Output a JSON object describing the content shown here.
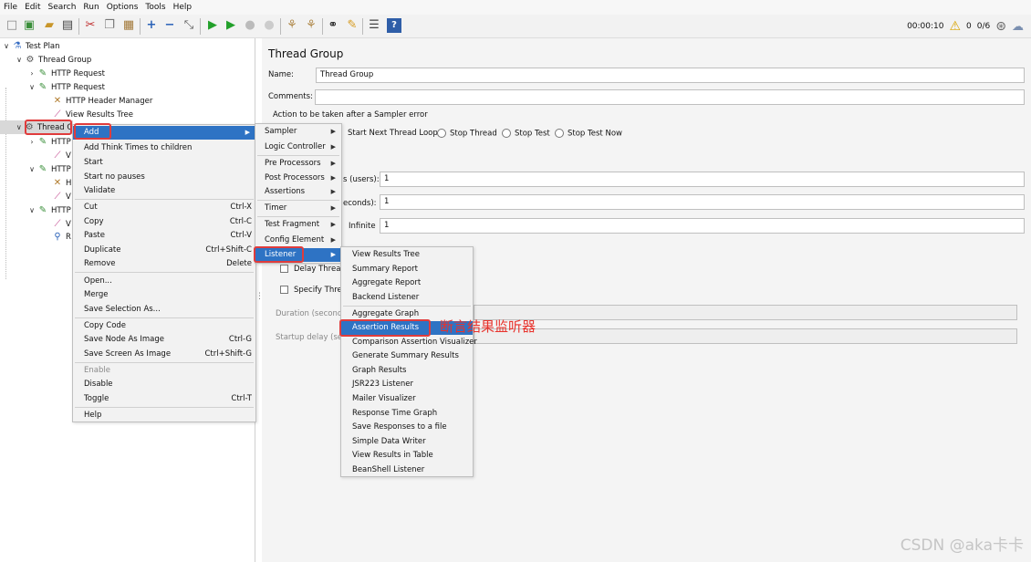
{
  "menubar": [
    "File",
    "Edit",
    "Search",
    "Run",
    "Options",
    "Tools",
    "Help"
  ],
  "toolbar": {
    "icons": [
      "new-icon",
      "templates-icon",
      "open-icon",
      "save-icon",
      "cut-icon",
      "copy-icon",
      "paste-icon",
      "expand-icon",
      "collapse-icon",
      "toggle-icon",
      "start-icon",
      "start-no-pauses-icon",
      "stop-icon",
      "shutdown-icon",
      "clear-icon",
      "clear-all-icon",
      "search-icon",
      "reset-search-icon",
      "function-helper-icon",
      "help-icon"
    ],
    "timer": "00:00:10",
    "warnings": "0",
    "threads": "0/6"
  },
  "tree": {
    "nodes": [
      {
        "label": "Test Plan",
        "icon": "test-plan-icon"
      },
      {
        "label": "Thread Group",
        "icon": "gear-icon"
      },
      {
        "label": "HTTP Request",
        "icon": "pipette-icon"
      },
      {
        "label": "HTTP Request",
        "icon": "pipette-icon"
      },
      {
        "label": "HTTP Header Manager",
        "icon": "wrench-icon"
      },
      {
        "label": "View Results Tree",
        "icon": "chart-icon"
      },
      {
        "label": "Thread G",
        "icon": "gear-icon"
      },
      {
        "label": "HTTP",
        "icon": "pipette-icon"
      },
      {
        "label": "V",
        "icon": "chart-icon"
      },
      {
        "label": "HTTP",
        "icon": "pipette-icon"
      },
      {
        "label": "H",
        "icon": "wrench-icon"
      },
      {
        "label": "V",
        "icon": "chart-icon"
      },
      {
        "label": "HTTP",
        "icon": "pipette-icon"
      },
      {
        "label": "V",
        "icon": "chart-icon"
      },
      {
        "label": "R",
        "icon": "search-icon"
      }
    ]
  },
  "panel": {
    "title": "Thread Group",
    "name_label": "Name:",
    "name_value": "Thread Group",
    "comments_label": "Comments:",
    "comments_value": "",
    "error_action_label": "Action to be taken after a Sampler error",
    "error_actions": [
      "Start Next Thread Loop",
      "Stop Thread",
      "Stop Test",
      "Stop Test Now"
    ],
    "threads_label": "s (users):",
    "threads_value": "1",
    "rampup_label": "econds):",
    "rampup_value": "1",
    "loop_label": "Infinite",
    "loop_value": "1",
    "delay_label": "Delay Thread",
    "specify_label": "Specify Threa",
    "duration_label": "Duration (seconds",
    "startup_label": "Startup delay (sec"
  },
  "context_menu": {
    "items": [
      {
        "label": "Add",
        "shortcut": "",
        "arrow": true
      },
      {
        "label": "Add Think Times to children",
        "shortcut": ""
      },
      {
        "label": "Start",
        "shortcut": ""
      },
      {
        "label": "Start no pauses",
        "shortcut": ""
      },
      {
        "label": "Validate",
        "shortcut": ""
      },
      {
        "label": "Cut",
        "shortcut": "Ctrl-X"
      },
      {
        "label": "Copy",
        "shortcut": "Ctrl-C"
      },
      {
        "label": "Paste",
        "shortcut": "Ctrl-V"
      },
      {
        "label": "Duplicate",
        "shortcut": "Ctrl+Shift-C"
      },
      {
        "label": "Remove",
        "shortcut": "Delete"
      },
      {
        "label": "Open...",
        "shortcut": ""
      },
      {
        "label": "Merge",
        "shortcut": ""
      },
      {
        "label": "Save Selection As...",
        "shortcut": ""
      },
      {
        "label": "Copy Code",
        "shortcut": ""
      },
      {
        "label": "Save Node As Image",
        "shortcut": "Ctrl-G"
      },
      {
        "label": "Save Screen As Image",
        "shortcut": "Ctrl+Shift-G"
      },
      {
        "label": "Enable",
        "shortcut": ""
      },
      {
        "label": "Disable",
        "shortcut": ""
      },
      {
        "label": "Toggle",
        "shortcut": "Ctrl-T"
      },
      {
        "label": "Help",
        "shortcut": ""
      }
    ]
  },
  "add_menu": {
    "items": [
      "Sampler",
      "Logic Controller",
      "Pre Processors",
      "Post Processors",
      "Assertions",
      "Timer",
      "Test Fragment",
      "Config Element",
      "Listener"
    ]
  },
  "listener_menu": {
    "items": [
      "View Results Tree",
      "Summary Report",
      "Aggregate Report",
      "Backend Listener",
      "Aggregate Graph",
      "Assertion Results",
      "Comparison Assertion Visualizer",
      "Generate Summary Results",
      "Graph Results",
      "JSR223 Listener",
      "Mailer Visualizer",
      "Response Time Graph",
      "Save Responses to a file",
      "Simple Data Writer",
      "View Results in Table",
      "BeanShell Listener"
    ]
  },
  "annotation": "断言结果监听器",
  "watermark": "CSDN @aka卡卡",
  "colors": {
    "highlight": "#2e73c4",
    "annotation": "#e8322c"
  }
}
